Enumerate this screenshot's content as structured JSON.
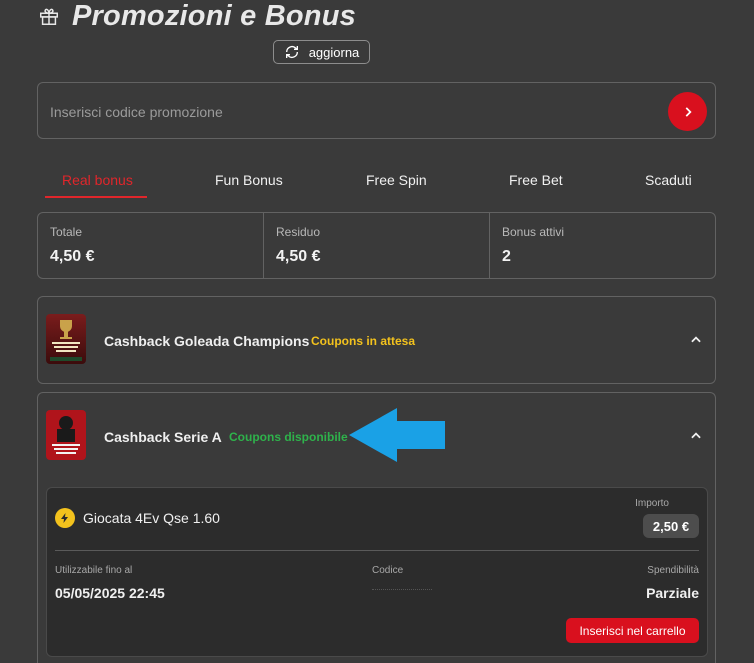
{
  "header": {
    "title": "Promozioni e Bonus",
    "refresh_label": "aggiorna"
  },
  "promo": {
    "placeholder": "Inserisci codice promozione"
  },
  "tabs": [
    {
      "label": "Real bonus",
      "active": true
    },
    {
      "label": "Fun Bonus"
    },
    {
      "label": "Free Spin"
    },
    {
      "label": "Free Bet"
    },
    {
      "label": "Scaduti"
    }
  ],
  "summary": [
    {
      "label": "Totale",
      "value": "4,50 €"
    },
    {
      "label": "Residuo",
      "value": "4,50 €"
    },
    {
      "label": "Bonus attivi",
      "value": "2"
    }
  ],
  "bonuses": [
    {
      "title": "Cashback Goleada Champions",
      "status": "Coupons in attesa",
      "status_color": "#f3c21d",
      "thumb_text": "GOLEADA CHAMPIONS LEAGUE"
    },
    {
      "title": "Cashback Serie A",
      "status": "Coupons disponibile",
      "status_color": "#2eb24b",
      "thumb_text": "CASHBACK SERIE A"
    }
  ],
  "coupon": {
    "name": "Giocata 4Ev Qse 1.60",
    "amount_label": "Importo",
    "amount": "2,50 €",
    "valid_label": "Utilizzabile fino al",
    "valid_value": "05/05/2025 22:45",
    "code_label": "Codice",
    "spend_label": "Spendibilità",
    "spend_value": "Parziale",
    "cart_label": "Inserisci nel carrello"
  },
  "colors": {
    "accent": "#d9101e",
    "background": "#3a3a3a",
    "arrow": "#1aa1e6"
  }
}
